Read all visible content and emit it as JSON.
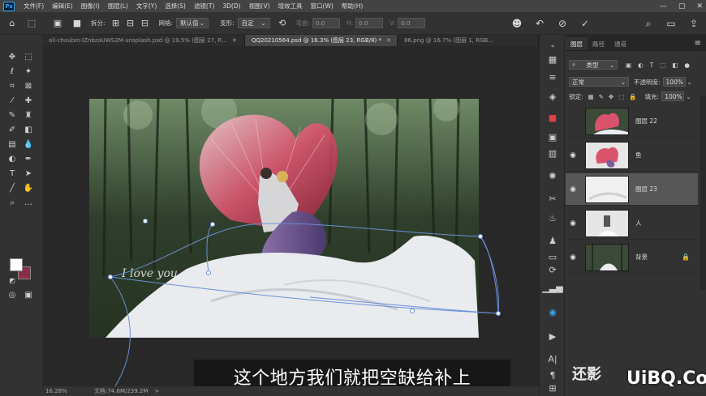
{
  "app": {
    "logo": "Ps"
  },
  "menu": [
    "文件(F)",
    "编辑(E)",
    "图像(I)",
    "图层(L)",
    "文字(Y)",
    "选择(S)",
    "滤镜(T)",
    "3D(D)",
    "视图(V)",
    "增效工具",
    "窗口(W)",
    "帮助(H)"
  ],
  "window": {
    "minimize": "—",
    "maximize": "▢",
    "close": "✕"
  },
  "options": {
    "split_label": "拆分:",
    "grid_label": "网格:",
    "grid_value": "默认值",
    "deform_label": "变形:",
    "deform_value": "自定",
    "bend_label": "弯曲:",
    "bend_value": "0.0",
    "h_label": "H:",
    "h_value": "0.0",
    "v_label": "V:",
    "v_value": "0.0"
  },
  "tabs": [
    {
      "label": "ali-choubin-IZnbzaUWS2M-unsplash.psd @ 19.5% (图层 27, R...",
      "close": "✕",
      "active": false
    },
    {
      "label": "QQ20210564.psd @ 16.3% (图层 23, RGB/8) *",
      "close": "✕",
      "active": true
    },
    {
      "label": "86.png @ 16.7% (图层 1, RGB...",
      "close": "",
      "active": false
    }
  ],
  "caption": "这个地方我们就把空缺给补上",
  "status": {
    "zoom": "16.28%",
    "doc": "文档:74.6M/239.2M",
    "arrow": ">"
  },
  "panel": {
    "tabs": [
      "图层",
      "路径",
      "通道"
    ],
    "menu_icon": "≡",
    "filter_label": "类型",
    "blend_mode": "正常",
    "opacity_label": "不透明度:",
    "opacity_value": "100%",
    "lock_label": "锁定:",
    "fill_label": "填充:",
    "fill_value": "100%",
    "layers": [
      {
        "name": "图层 22",
        "visible": false,
        "selected": false,
        "locked": false
      },
      {
        "name": "鱼",
        "visible": true,
        "selected": false,
        "locked": false
      },
      {
        "name": "图层 23",
        "visible": true,
        "selected": true,
        "locked": false
      },
      {
        "name": "人",
        "visible": true,
        "selected": false,
        "locked": false
      },
      {
        "name": "背景",
        "visible": true,
        "selected": false,
        "locked": true
      }
    ]
  },
  "watermark": {
    "text1": "还影",
    "text2": "UiBQ.CoM"
  },
  "colors": {
    "foreground": "#ffffff",
    "background": "#8a2f4a",
    "accent": "#31a8ff"
  }
}
